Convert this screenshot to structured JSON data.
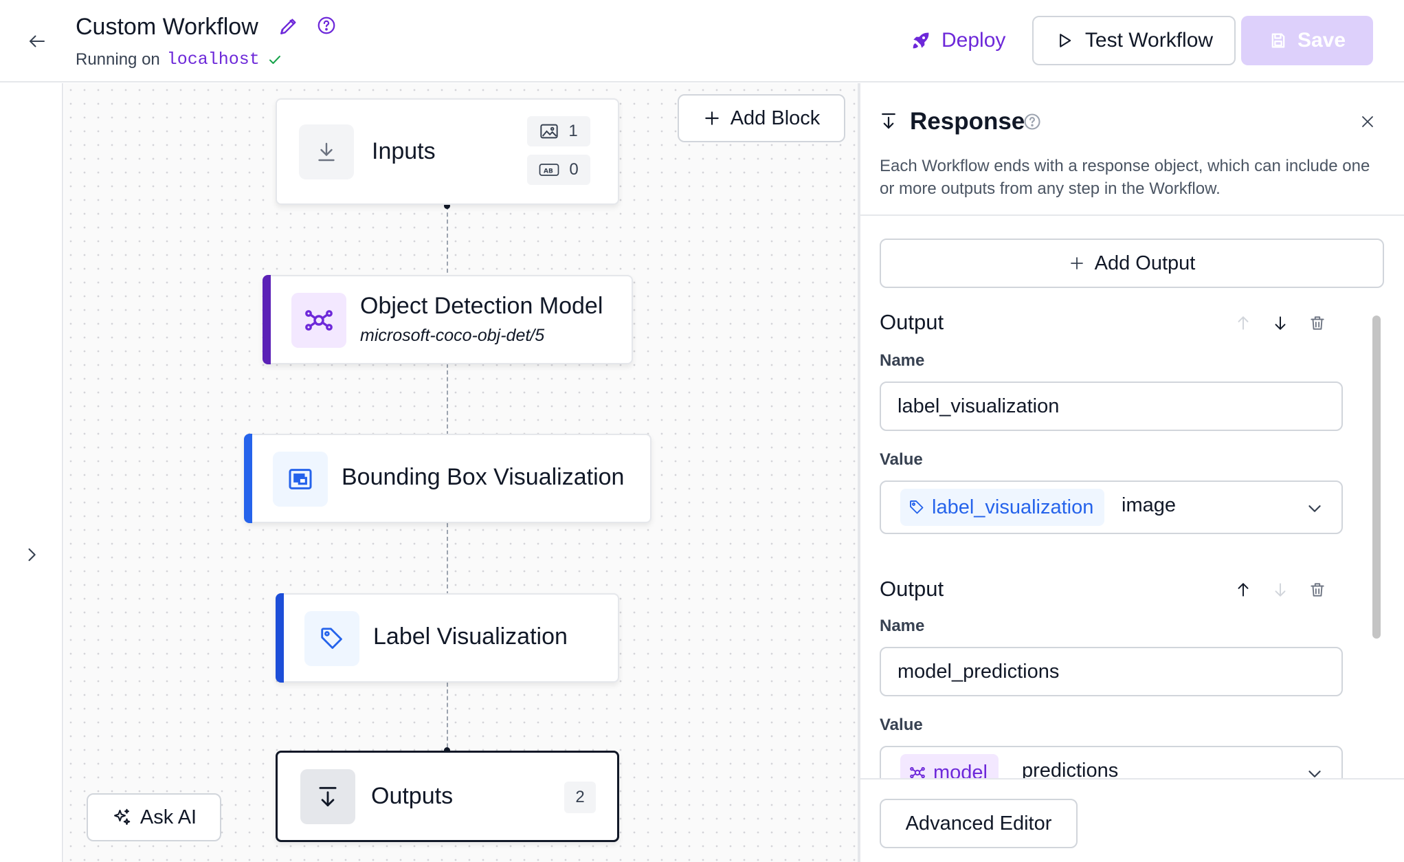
{
  "header": {
    "title": "Custom Workflow",
    "status_prefix": "Running on",
    "status_host": "localhost",
    "deploy_label": "Deploy",
    "test_label": "Test Workflow",
    "save_label": "Save"
  },
  "canvas": {
    "add_block_label": "Add Block",
    "ask_ai_label": "Ask AI",
    "nodes": {
      "inputs": {
        "title": "Inputs",
        "image_count": "1",
        "param_count": "0"
      },
      "object_detection": {
        "title": "Object Detection Model",
        "subtitle": "microsoft-coco-obj-det/5",
        "accent": "#5b21b6"
      },
      "bbox_viz": {
        "title": "Bounding Box Visualization",
        "accent": "#2563eb"
      },
      "label_viz": {
        "title": "Label Visualization",
        "accent": "#1d4ed8"
      },
      "outputs": {
        "title": "Outputs",
        "count": "2"
      }
    }
  },
  "panel": {
    "title": "Response",
    "description": "Each Workflow ends with a response object, which can include one or more outputs from any step in the Workflow.",
    "add_output_label": "Add Output",
    "outputs": [
      {
        "heading": "Output",
        "name_label": "Name",
        "name_value": "label_visualization",
        "value_label": "Value",
        "value_step": "label_visualization",
        "value_field": "image"
      },
      {
        "heading": "Output",
        "name_label": "Name",
        "name_value": "model_predictions",
        "value_label": "Value",
        "value_step": "model",
        "value_field": "predictions"
      }
    ],
    "advanced_editor_label": "Advanced Editor"
  },
  "colors": {
    "brand_purple": "#6d28d9",
    "save_disabled": "#ddd0fb",
    "chip_blue": "#2563eb"
  },
  "icons": {
    "back": "arrow-left-icon",
    "edit": "pencil-icon",
    "help": "question-circle-icon",
    "deploy": "rocket-icon",
    "test": "play-icon",
    "save": "floppy-disk-icon",
    "inputs": "download-icon",
    "outputs": "download-icon",
    "object_detection": "network-icon",
    "bbox": "bounding-box-icon",
    "label": "tag-icon",
    "ask_ai": "sparkles-icon"
  }
}
